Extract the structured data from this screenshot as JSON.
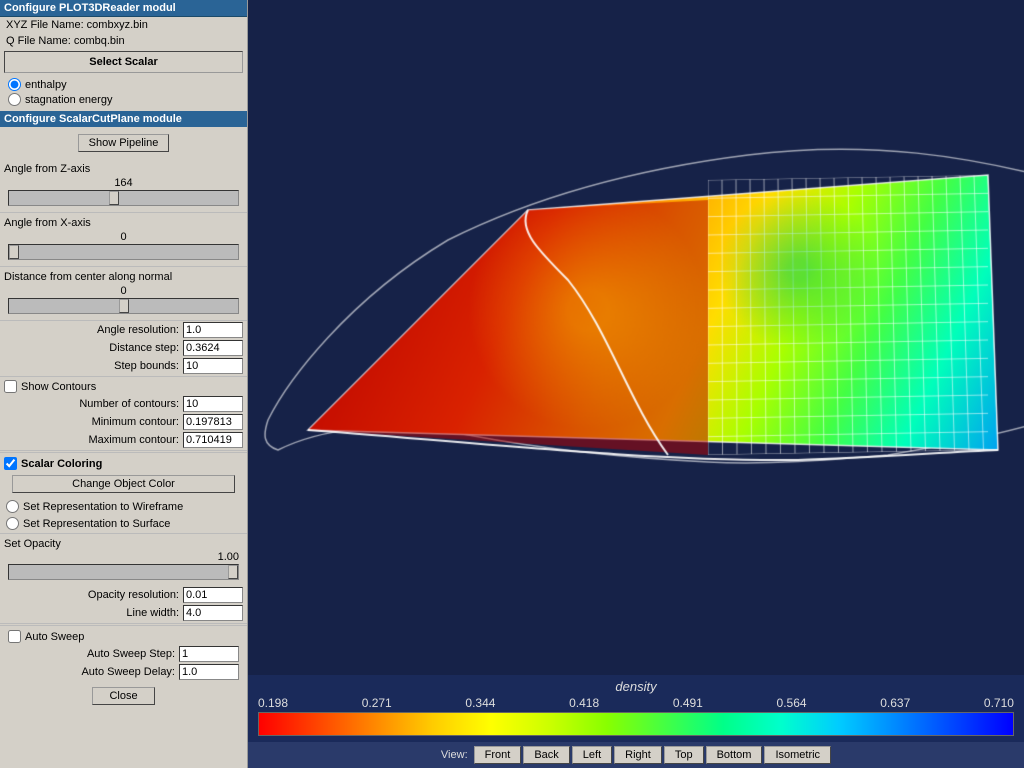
{
  "window": {
    "title": "Configure PLOT3DReader modul"
  },
  "left_panel": {
    "xyz_file": "XYZ File Name: combxyz.bin",
    "q_file": "Q File Name: combq.bin",
    "select_scalar_label": "Select Scalar",
    "scalars": [
      {
        "label": "enthalpy",
        "selected": true
      },
      {
        "label": "stagnation energy",
        "selected": false
      }
    ],
    "show_pipeline_label": "Show Pipeline",
    "configure_module_title": "Configure ScalarCutPlane module",
    "angle_z_label": "Angle from Z-axis",
    "angle_z_value": "164",
    "angle_x_label": "Angle from X-axis",
    "angle_x_value": "0",
    "distance_label": "Distance from center along normal",
    "distance_value": "0",
    "angle_resolution_label": "Angle resolution:",
    "angle_resolution_value": "1.0",
    "distance_step_label": "Distance step:",
    "distance_step_value": "0.3624",
    "step_bounds_label": "Step bounds:",
    "step_bounds_value": "10",
    "show_contours_label": "Show Contours",
    "show_contours_checked": false,
    "num_contours_label": "Number of contours:",
    "num_contours_value": "10",
    "min_contour_label": "Minimum contour:",
    "min_contour_value": "0.197813",
    "max_contour_label": "Maximum contour:",
    "max_contour_value": "0.710419",
    "scalar_coloring_label": "Scalar Coloring",
    "scalar_coloring_checked": true,
    "change_color_label": "Change Object Color",
    "wireframe_label": "Set Representation to Wireframe",
    "surface_label": "Set Representation to Surface",
    "opacity_label": "Set Opacity",
    "opacity_value": "1.00",
    "opacity_resolution_label": "Opacity resolution:",
    "opacity_resolution_value": "0.01",
    "line_width_label": "Line width:",
    "line_width_value": "4.0",
    "auto_sweep_label": "Auto Sweep",
    "auto_sweep_checked": false,
    "auto_sweep_step_label": "Auto Sweep Step:",
    "auto_sweep_step_value": "1",
    "auto_sweep_delay_label": "Auto Sweep Delay:",
    "auto_sweep_delay_value": "1.0",
    "close_label": "Close"
  },
  "colorbar": {
    "title": "density",
    "values": [
      "0.198",
      "0.271",
      "0.344",
      "0.418",
      "0.491",
      "0.564",
      "0.637",
      "0.710"
    ]
  },
  "view_buttons": {
    "view_label": "View:",
    "buttons": [
      "Front",
      "Back",
      "Left",
      "Right",
      "Top",
      "Bottom",
      "Isometric"
    ]
  }
}
